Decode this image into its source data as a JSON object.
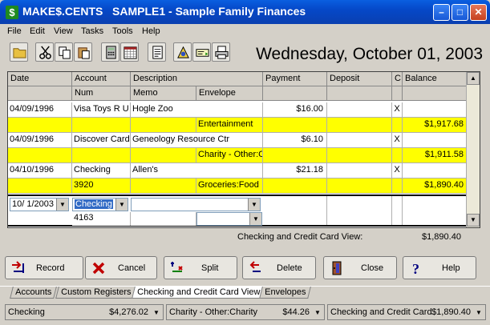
{
  "window": {
    "app_name": "MAKE$.CENTS",
    "file_name": "SAMPLE1",
    "title_rest": "- Sample Family Finances"
  },
  "menu": [
    "File",
    "Edit",
    "View",
    "Tasks",
    "Tools",
    "Help"
  ],
  "date_display": "Wednesday, October 01, 2003",
  "register": {
    "headers": {
      "date": "Date",
      "account": "Account",
      "num": "Num",
      "description": "Description",
      "memo": "Memo",
      "envelope": "Envelope",
      "payment": "Payment",
      "deposit": "Deposit",
      "c": "C",
      "balance": "Balance"
    },
    "rows": [
      {
        "date": "04/09/1996",
        "account": "Visa Toys R U",
        "description": "Hogle Zoo",
        "payment": "$16.00",
        "deposit": "",
        "c": "X",
        "num": "",
        "memo": "",
        "envelope": "Entertainment",
        "balance": "$1,917.68"
      },
      {
        "date": "04/09/1996",
        "account": "Discover Card",
        "description": "Geneology Resource Ctr",
        "payment": "$6.10",
        "deposit": "",
        "c": "X",
        "num": "",
        "memo": "",
        "envelope": "Charity - Other:C",
        "balance": "$1,911.58"
      },
      {
        "date": "04/10/1996",
        "account": "Checking",
        "description": "Allen's",
        "payment": "$21.18",
        "deposit": "",
        "c": "X",
        "num": "3920",
        "memo": "",
        "envelope": "Groceries:Food",
        "balance": "$1,890.40"
      }
    ],
    "entry": {
      "date": "10/ 1/2003",
      "account": "Checking",
      "num": "4163"
    }
  },
  "summary": {
    "label": "Checking and Credit Card View:",
    "value": "$1,890.40"
  },
  "actions": {
    "record": "Record",
    "cancel": "Cancel",
    "split": "Split",
    "delete": "Delete",
    "close": "Close",
    "help": "Help"
  },
  "tabs": [
    "Accounts",
    "Custom Registers",
    "Checking and Credit Card View",
    "Envelopes"
  ],
  "status": [
    {
      "name": "Checking",
      "value": "$4,276.02"
    },
    {
      "name": "Charity - Other:Charity",
      "value": "$44.26"
    },
    {
      "name": "Checking and Credit Card",
      "value": "$1,890.40"
    }
  ],
  "colors": {
    "titlebar": "#0548c8",
    "highlight_row": "#ffff00",
    "selection": "#316ac5"
  }
}
